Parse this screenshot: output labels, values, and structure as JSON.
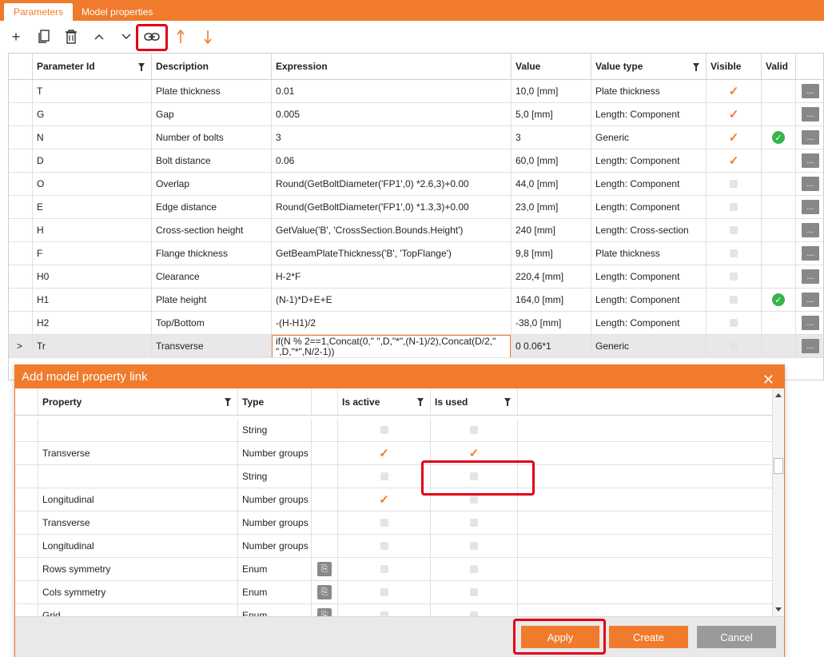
{
  "tabs": [
    {
      "label": "Parameters",
      "active": true
    },
    {
      "label": "Model properties",
      "active": false
    }
  ],
  "toolbar": {
    "icons": [
      "add-icon",
      "copy-icon",
      "delete-icon",
      "move-up-icon",
      "move-down-icon",
      "link-icon",
      "sort-up-arrow-icon",
      "sort-down-arrow-icon"
    ],
    "add_label": "+",
    "accent_color": "#f07b2c",
    "highlight_color": "#e0001a"
  },
  "grid": {
    "columns": [
      "Parameter Id",
      "Description",
      "Expression",
      "Value",
      "Value type",
      "Visible",
      "Valid"
    ],
    "rows": [
      {
        "id": "T",
        "description": "Plate thickness",
        "expression": "0.01",
        "value": "10,0 [mm]",
        "value_type": "Plate thickness",
        "visible": true,
        "valid": false,
        "selected": false
      },
      {
        "id": "G",
        "description": "Gap",
        "expression": "0.005",
        "value": "5,0 [mm]",
        "value_type": "Length: Component",
        "visible": true,
        "valid": false,
        "selected": false
      },
      {
        "id": "N",
        "description": "Number of bolts",
        "expression": "3",
        "value": "3",
        "value_type": "Generic",
        "visible": true,
        "valid": true,
        "selected": false
      },
      {
        "id": "D",
        "description": "Bolt distance",
        "expression": "0.06",
        "value": "60,0 [mm]",
        "value_type": "Length: Component",
        "visible": true,
        "valid": false,
        "selected": false
      },
      {
        "id": "O",
        "description": "Overlap",
        "expression": "Round(GetBoltDiameter('FP1',0) *2.6,3)+0.00",
        "value": "44,0 [mm]",
        "value_type": "Length: Component",
        "visible": false,
        "valid": false,
        "selected": false
      },
      {
        "id": "E",
        "description": "Edge distance",
        "expression": "Round(GetBoltDiameter('FP1',0) *1.3,3)+0.00",
        "value": "23,0 [mm]",
        "value_type": "Length: Component",
        "visible": false,
        "valid": false,
        "selected": false
      },
      {
        "id": "H",
        "description": "Cross-section height",
        "expression": "GetValue('B', 'CrossSection.Bounds.Height')",
        "value": "240 [mm]",
        "value_type": "Length: Cross-section",
        "visible": false,
        "valid": false,
        "selected": false
      },
      {
        "id": "F",
        "description": "Flange thickness",
        "expression": "GetBeamPlateThickness('B', 'TopFlange')",
        "value": "9,8 [mm]",
        "value_type": "Plate thickness",
        "visible": false,
        "valid": false,
        "selected": false
      },
      {
        "id": "H0",
        "description": "Clearance",
        "expression": "H-2*F",
        "value": "220,4 [mm]",
        "value_type": "Length: Component",
        "visible": false,
        "valid": false,
        "selected": false
      },
      {
        "id": "H1",
        "description": "Plate height",
        "expression": "(N-1)*D+E+E",
        "value": "164,0 [mm]",
        "value_type": "Length: Component",
        "visible": false,
        "valid": true,
        "selected": false
      },
      {
        "id": "H2",
        "description": "Top/Bottom",
        "expression": "-(H-H1)/2",
        "value": "-38,0 [mm]",
        "value_type": "Length: Component",
        "visible": false,
        "valid": false,
        "selected": false
      },
      {
        "id": "Tr",
        "description": "Transverse",
        "expression": "if(N % 2==1,Concat(0,\" \",D,\"*\",(N-1)/2),Concat(D/2,\" \",D,\"*\",N/2-1))",
        "value": "0 0.06*1",
        "value_type": "Generic",
        "visible": false,
        "valid": false,
        "selected": true
      }
    ],
    "row_marker": ">",
    "dots_label": "..."
  },
  "dialog": {
    "title": "Add model property link",
    "close_label": "✕",
    "columns": [
      "Property",
      "Type",
      "",
      "Is active",
      "Is used"
    ],
    "rows": [
      {
        "property": "",
        "type": "String",
        "copy": false,
        "is_active": false,
        "is_used": false
      },
      {
        "property": "Transverse",
        "type": "Number groups",
        "copy": false,
        "is_active": true,
        "is_used": true
      },
      {
        "property": "",
        "type": "String",
        "copy": false,
        "is_active": false,
        "is_used": false
      },
      {
        "property": "Longitudinal",
        "type": "Number groups",
        "copy": false,
        "is_active": true,
        "is_used": false
      },
      {
        "property": "Transverse",
        "type": "Number groups",
        "copy": false,
        "is_active": false,
        "is_used": false
      },
      {
        "property": "Longitudinal",
        "type": "Number groups",
        "copy": false,
        "is_active": false,
        "is_used": false
      },
      {
        "property": "Rows symmetry",
        "type": "Enum",
        "copy": true,
        "is_active": false,
        "is_used": false
      },
      {
        "property": "Cols symmetry",
        "type": "Enum",
        "copy": true,
        "is_active": false,
        "is_used": false
      },
      {
        "property": "Grid",
        "type": "Enum",
        "copy": true,
        "is_active": false,
        "is_used": false
      }
    ],
    "buttons": {
      "apply": "Apply",
      "create": "Create",
      "cancel": "Cancel"
    }
  }
}
